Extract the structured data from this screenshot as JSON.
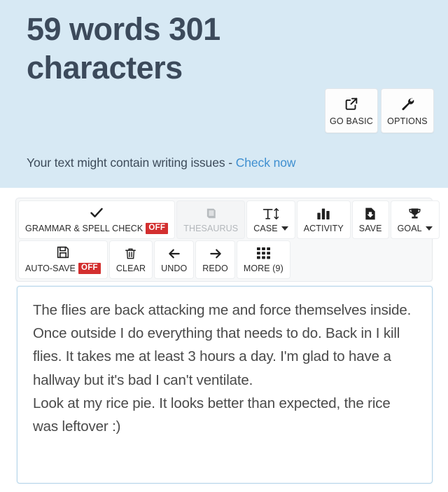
{
  "header": {
    "counter_title": "59 words 301 characters",
    "actions": [
      {
        "label": "GO BASIC",
        "icon": "external-link-icon"
      },
      {
        "label": "OPTIONS",
        "icon": "wrench-icon"
      }
    ],
    "notice": {
      "text": "Your text might contain writing issues - ",
      "link_label": "Check now",
      "link_color": "#3f8fd0"
    },
    "background_color": "#d7e9f4",
    "title_color": "#3c4a5b"
  },
  "toolbar": {
    "row1": [
      {
        "label": "GRAMMAR & SPELL CHECK",
        "icon": "check-icon",
        "badge": "OFF",
        "disabled": false
      },
      {
        "label": "THESAURUS",
        "icon": "book-icon",
        "badge": "",
        "disabled": true
      },
      {
        "label": "CASE",
        "icon": "text-case-icon",
        "caret": true,
        "disabled": false
      },
      {
        "label": "ACTIVITY",
        "icon": "bar-chart-icon",
        "disabled": false
      },
      {
        "label": "SAVE",
        "icon": "save-document-icon",
        "disabled": false
      },
      {
        "label": "GOAL",
        "icon": "trophy-icon",
        "caret": true,
        "disabled": false
      }
    ],
    "row2": [
      {
        "label": "AUTO-SAVE",
        "icon": "floppy-disk-icon",
        "badge": "OFF",
        "disabled": false
      },
      {
        "label": "CLEAR",
        "icon": "trash-icon",
        "disabled": false
      },
      {
        "label": "UNDO",
        "icon": "arrow-left-icon",
        "disabled": false
      },
      {
        "label": "REDO",
        "icon": "arrow-right-icon",
        "disabled": false
      },
      {
        "label": "MORE (9)",
        "icon": "grid-icon",
        "disabled": false
      }
    ],
    "badge_color": "#d32f2f"
  },
  "editor": {
    "paragraph1": "The flies are back attacking me and force themselves inside. Once outside I do everything that needs to do. Back in I kill flies. It takes me at least 3 hours a day. I'm glad to have a hallway but it's bad I can't ventilate.",
    "paragraph2": "Look at my rice pie. It looks better than expected, the rice was leftover :)",
    "border_color": "#b6d5ea"
  }
}
